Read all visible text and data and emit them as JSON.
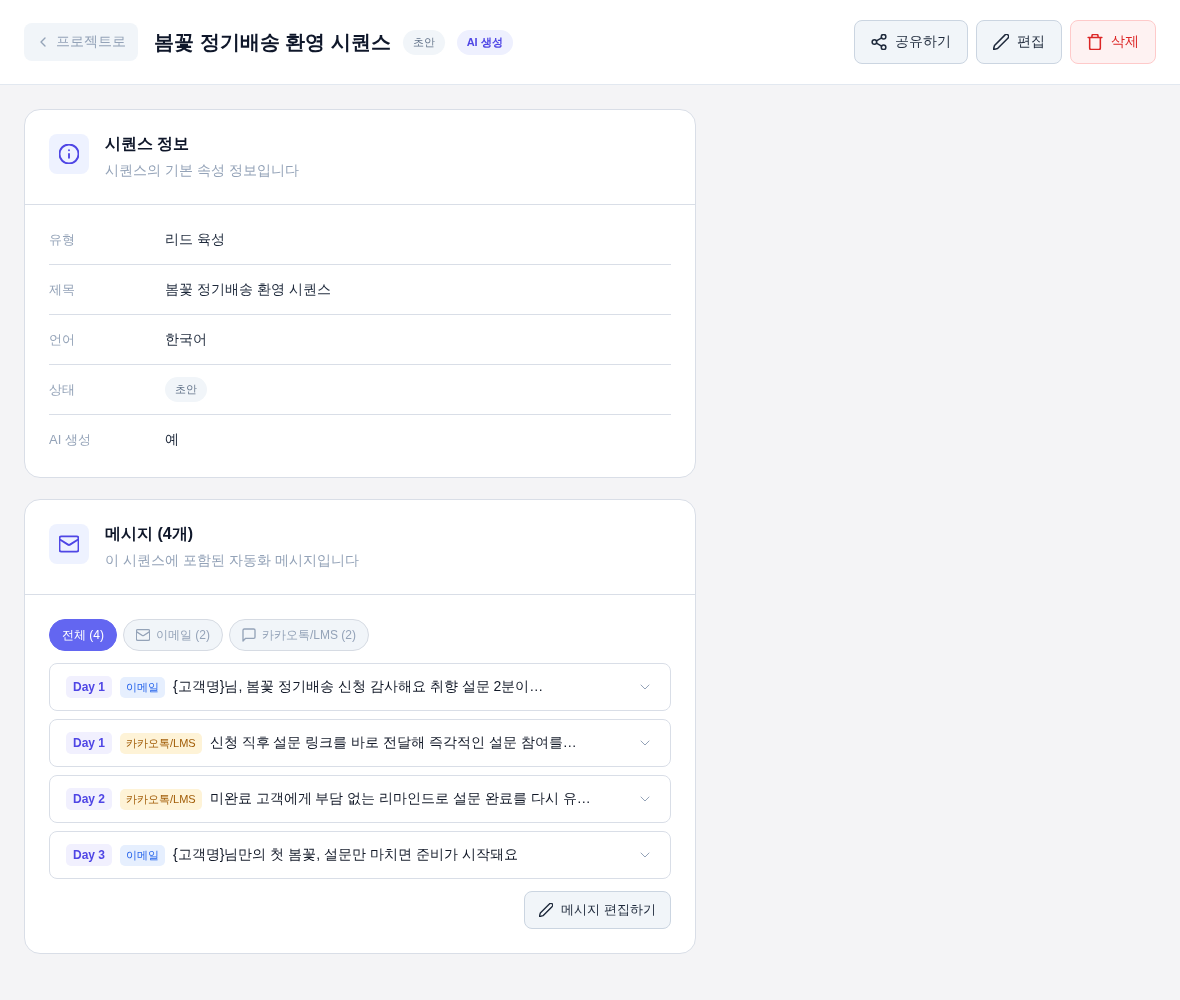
{
  "header": {
    "back_link": "프로젝트로",
    "title": "봄꽃 정기배송 환영 시퀀스",
    "badges": [
      {
        "kind": "status",
        "label": "초안"
      },
      {
        "kind": "ai",
        "label": "AI 생성"
      }
    ],
    "actions": [
      {
        "kind": "share",
        "label": "공유하기"
      },
      {
        "kind": "edit",
        "label": "편집"
      },
      {
        "kind": "delete",
        "label": "삭제"
      }
    ]
  },
  "info_card": {
    "title": "시퀀스 정보",
    "subtitle": "시퀀스의 기본 속성 정보입니다",
    "rows": [
      {
        "label": "유형",
        "kind": "text",
        "value": "리드 육성"
      },
      {
        "label": "제목",
        "kind": "text",
        "value": "봄꽃 정기배송 환영 시퀀스"
      },
      {
        "label": "언어",
        "kind": "text",
        "value": "한국어"
      },
      {
        "label": "상태",
        "kind": "badge",
        "value": "초안"
      },
      {
        "label": "AI 생성",
        "kind": "text",
        "value": "예"
      }
    ]
  },
  "messages_card": {
    "title": "메시지 (4개)",
    "subtitle": "이 시퀀스에 포함된 자동화 메시지입니다",
    "filters": [
      {
        "kind": "all",
        "label": "전체 (4)",
        "selected": true
      },
      {
        "kind": "email",
        "label": "이메일 (2)",
        "selected": false
      },
      {
        "kind": "kakao",
        "label": "카카오톡/LMS (2)",
        "selected": false
      }
    ],
    "messages": [
      {
        "day": "Day 1",
        "kind": "email",
        "channel": "이메일",
        "subject": "{고객명}님, 봄꽃 정기배송 신청 감사해요 취향 설문 2분이…",
        "expanded": false
      },
      {
        "day": "Day 1",
        "kind": "kakao",
        "channel": "카카오톡/LMS",
        "subject": "신청 직후 설문 링크를 바로 전달해 즉각적인 설문 참여를…",
        "expanded": false
      },
      {
        "day": "Day 2",
        "kind": "kakao",
        "channel": "카카오톡/LMS",
        "subject": "미완료 고객에게 부담 없는 리마인드로 설문 완료를 다시 유…",
        "expanded": false
      },
      {
        "day": "Day 3",
        "kind": "email",
        "channel": "이메일",
        "subject": "{고객명}님만의 첫 봄꽃, 설문만 마치면 준비가 시작돼요",
        "expanded": false
      }
    ],
    "edit_button": "메시지 편집하기"
  }
}
